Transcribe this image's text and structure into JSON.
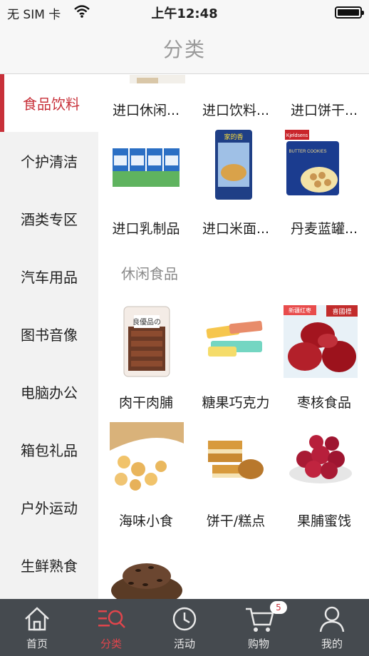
{
  "status_bar": {
    "carrier": "无 SIM 卡",
    "time": "上午12:48"
  },
  "nav": {
    "title": "分类"
  },
  "sidebar": {
    "items": [
      {
        "label": "食品饮料",
        "active": true
      },
      {
        "label": "个护清洁"
      },
      {
        "label": "酒类专区"
      },
      {
        "label": "汽车用品"
      },
      {
        "label": "图书音像"
      },
      {
        "label": "电脑办公"
      },
      {
        "label": "箱包礼品"
      },
      {
        "label": "户外运动"
      },
      {
        "label": "生鲜熟食"
      }
    ]
  },
  "content": {
    "group1": [
      {
        "label": "进口休闲...",
        "image": "snack-package"
      },
      {
        "label": "进口饮料...",
        "image": "drink-bottle"
      },
      {
        "label": "进口饼干...",
        "image": "biscuit-box"
      },
      {
        "label": "进口乳制品",
        "image": "milk-cartons"
      },
      {
        "label": "进口米面...",
        "image": "rice-bag"
      },
      {
        "label": "丹麦蓝罐...",
        "image": "cookie-tin"
      }
    ],
    "section2_title": "休闲食品",
    "group2": [
      {
        "label": "肉干肉脯",
        "image": "jerky-bag"
      },
      {
        "label": "糖果巧克力",
        "image": "candy-bars"
      },
      {
        "label": "枣核食品",
        "image": "red-dates"
      },
      {
        "label": "海味小食",
        "image": "dried-scallops"
      },
      {
        "label": "饼干/糕点",
        "image": "wafers"
      },
      {
        "label": "果脯蜜饯",
        "image": "preserved-fruit"
      },
      {
        "label": "",
        "image": "roasted-seeds"
      }
    ],
    "thumb_text": {
      "jerky": "良優品の",
      "dates_tag": "新疆红枣",
      "dates_brand": "喜國標",
      "cookie_brand": "Kjeldsens",
      "cookie_name": "BUTTER COOKIES",
      "rice_brand": "家的香"
    }
  },
  "tabbar": {
    "tabs": [
      {
        "label": "首页",
        "icon": "home-icon"
      },
      {
        "label": "分类",
        "icon": "category-search-icon",
        "active": true
      },
      {
        "label": "活动",
        "icon": "clock-icon"
      },
      {
        "label": "购物",
        "icon": "cart-icon",
        "badge": "5"
      },
      {
        "label": "我的",
        "icon": "user-icon"
      }
    ]
  },
  "colors": {
    "accent": "#c8313a",
    "tabbar_bg": "#454a4f",
    "sidebar_bg": "#f2f2f2"
  }
}
